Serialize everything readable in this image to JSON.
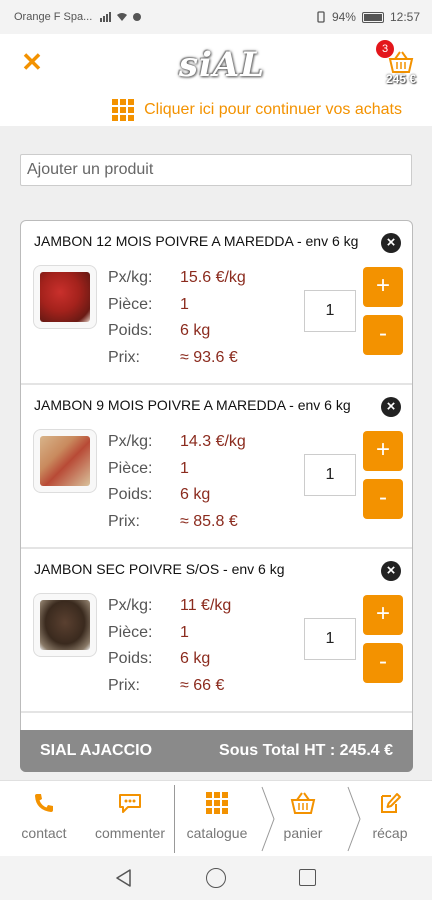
{
  "statusbar": {
    "carrier": "Orange F Spa...",
    "battery": "94%",
    "time": "12:57"
  },
  "header": {
    "close_icon": "close-x-icon",
    "logo_text": "siAL",
    "cart_badge": "3",
    "cart_total": "245 €"
  },
  "continue": {
    "label": "Cliquer ici pour continuer vos achats"
  },
  "search": {
    "placeholder": "Ajouter un produit"
  },
  "labels": {
    "price_kg": "Px/kg:",
    "piece": "Pièce:",
    "weight": "Poids:",
    "price": "Prix:"
  },
  "items": [
    {
      "name": "JAMBON 12 MOIS POIVRE A MAREDDA - env 6 kg",
      "price_kg": "15.6 €/kg",
      "piece": "1",
      "weight": "6 kg",
      "price": "≈ 93.6 €",
      "qty": "1"
    },
    {
      "name": "JAMBON 9 MOIS POIVRE A MAREDDA - env 6 kg",
      "price_kg": "14.3 €/kg",
      "piece": "1",
      "weight": "6 kg",
      "price": "≈ 85.8 €",
      "qty": "1"
    },
    {
      "name": "JAMBON SEC POIVRE S/OS - env 6 kg",
      "price_kg": "11 €/kg",
      "piece": "1",
      "weight": "6 kg",
      "price": "≈ 66 €",
      "qty": "1"
    }
  ],
  "buttons": {
    "plus": "+",
    "minus": "-",
    "remove": "×"
  },
  "subtotal": {
    "store": "SIAL AJACCIO",
    "label": "Sous Total HT : 245.4 €"
  },
  "nav": [
    {
      "label": "contact",
      "icon": "phone-icon"
    },
    {
      "label": "commenter",
      "icon": "chat-icon"
    },
    {
      "label": "catalogue",
      "icon": "grid-icon"
    },
    {
      "label": "panier",
      "icon": "basket-icon"
    },
    {
      "label": "récap",
      "icon": "edit-icon"
    }
  ],
  "colors": {
    "accent": "#f39200",
    "price": "#8b2b1e",
    "subtotal_bg": "#8a8a8a",
    "badge": "#e3161b"
  }
}
